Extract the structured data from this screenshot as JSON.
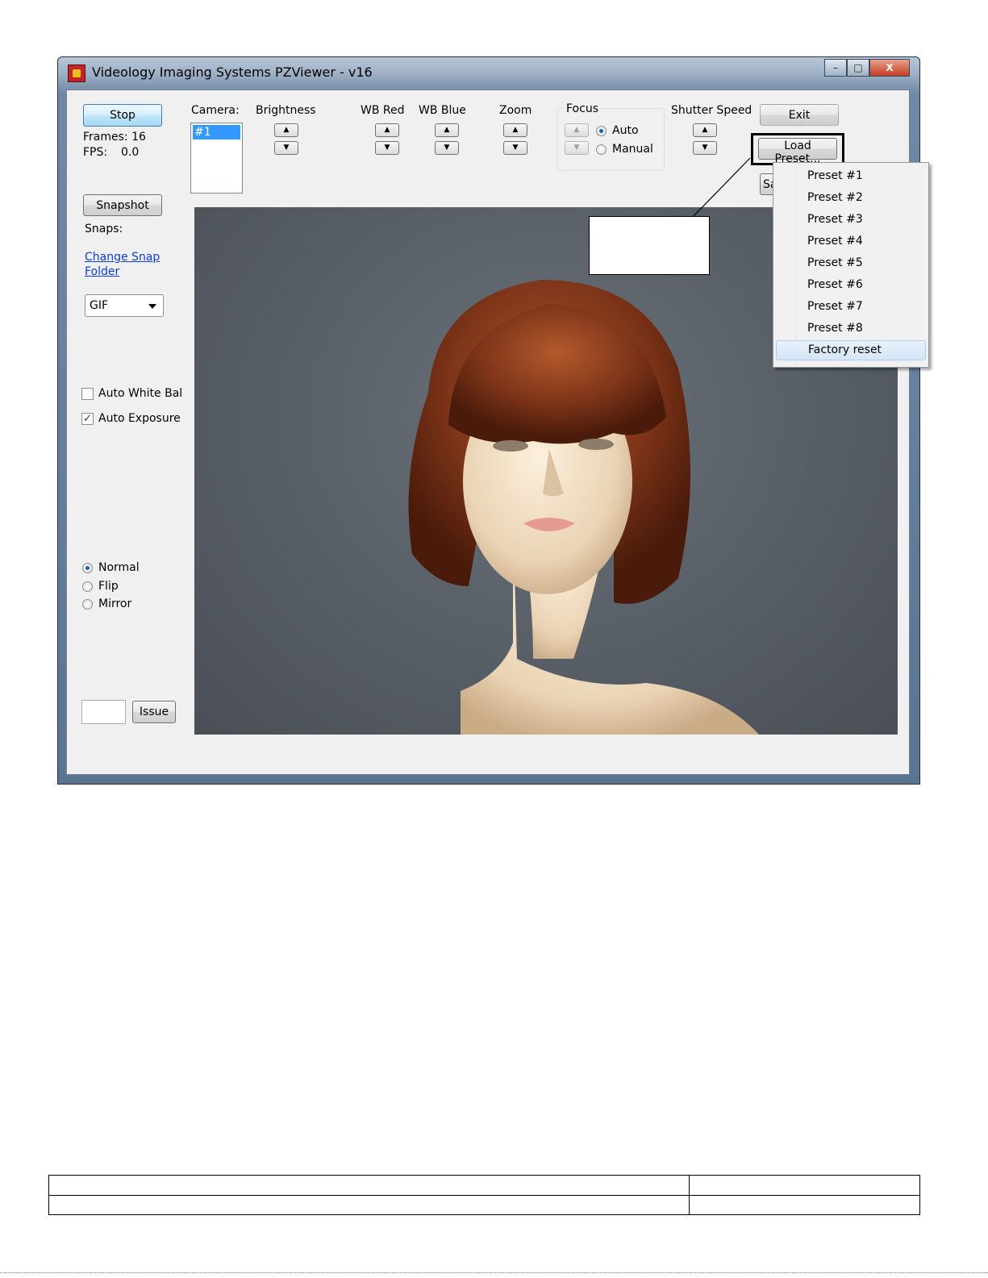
{
  "window": {
    "title": "Videology Imaging Systems PZViewer - v16",
    "controls": {
      "minimize": "–",
      "maximize": "□",
      "close": "X"
    }
  },
  "left_panel": {
    "stop_label": "Stop",
    "frames": "Frames: 16",
    "fps_label": "FPS:",
    "fps_value": "0.0",
    "snapshot_label": "Snapshot",
    "snaps_label": "Snaps:",
    "change_snap_folder_line1": "Change Snap",
    "change_snap_folder_line2": "Folder",
    "format_selected": "GIF",
    "auto_white_bal": {
      "label": "Auto White Bal",
      "checked": false
    },
    "auto_exposure": {
      "label": "Auto Exposure",
      "checked": true
    },
    "orientation": [
      {
        "label": "Normal",
        "selected": true
      },
      {
        "label": "Flip",
        "selected": false
      },
      {
        "label": "Mirror",
        "selected": false
      }
    ],
    "issue_label": "Issue",
    "issue_value": ""
  },
  "top_bar": {
    "camera_label": "Camera:",
    "camera_items": [
      "#1"
    ],
    "brightness_label": "Brightness",
    "wb_red_label": "WB Red",
    "wb_blue_label": "WB Blue",
    "zoom_label": "Zoom",
    "focus_label": "Focus",
    "focus_auto": "Auto",
    "focus_manual": "Manual",
    "shutter_label": "Shutter Speed",
    "exit_label": "Exit",
    "load_preset_label": "Load Preset...",
    "save_partial": "Sa"
  },
  "icons": {
    "up": "▲",
    "down": "▼",
    "check": "✓"
  },
  "preset_menu": [
    "Preset #1",
    "Preset #2",
    "Preset #3",
    "Preset #4",
    "Preset #5",
    "Preset #6",
    "Preset #7",
    "Preset #8",
    "Factory reset"
  ],
  "colors": {
    "selection": "#3399ff",
    "link": "#0a3cd6",
    "hair": "#8a3d1e",
    "skin": "#f2dcc2",
    "background": "#5b6168"
  }
}
